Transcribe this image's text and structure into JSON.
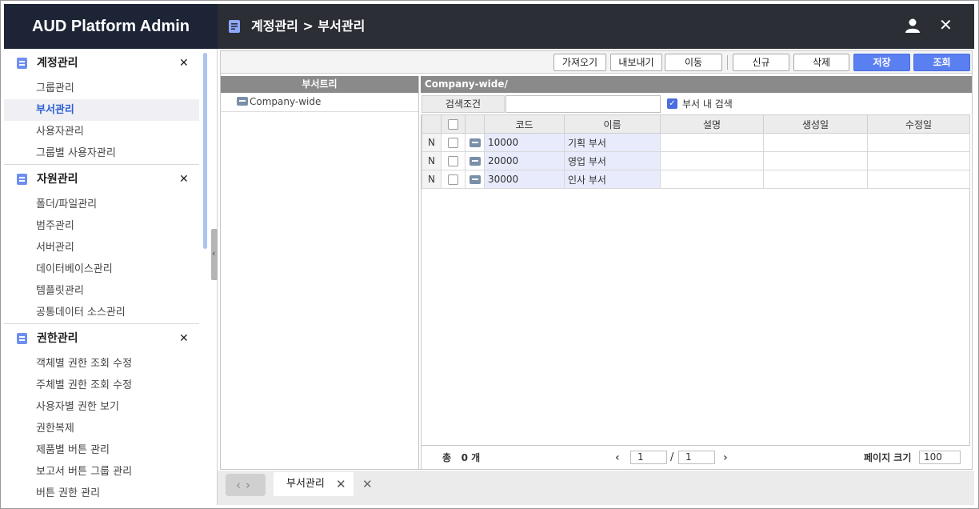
{
  "app": {
    "brand": "AUD Platform Admin"
  },
  "header": {
    "breadcrumb": "계정관리 > 부서관리"
  },
  "sidebar": {
    "groups": [
      {
        "label": "계정관리",
        "items": [
          "그룹관리",
          "부서관리",
          "사용자관리",
          "그룹별 사용자관리"
        ],
        "active": "부서관리"
      },
      {
        "label": "자원관리",
        "items": [
          "폴더/파일관리",
          "범주관리",
          "서버관리",
          "데이터베이스관리",
          "템플릿관리",
          "공통데이터 소스관리"
        ]
      },
      {
        "label": "권한관리",
        "items": [
          "객체별 권한 조회 수정",
          "주체별 권한 조회 수정",
          "사용자별 권한 보기",
          "권한복제",
          "제품별 버튼 관리",
          "보고서 버튼 그룹 관리",
          "버튼 권한 관리"
        ]
      }
    ]
  },
  "toolbar": {
    "import": "가져오기",
    "export": "내보내기",
    "move": "이동",
    "new": "신규",
    "delete": "삭제",
    "save": "저장",
    "search": "조회"
  },
  "tree": {
    "title": "부서트리",
    "nodes": [
      "Company-wide"
    ]
  },
  "grid": {
    "path": "Company-wide/",
    "search_label": "검색조건",
    "search_value": "",
    "within_dept_label": "부서 내 검색",
    "within_dept_checked": true,
    "columns": [
      "코드",
      "이름",
      "설명",
      "생성일",
      "수정일"
    ],
    "rows": [
      {
        "state": "N",
        "code": "10000",
        "name": "기획 부서",
        "desc": "",
        "created": "",
        "modified": ""
      },
      {
        "state": "N",
        "code": "20000",
        "name": "영업 부서",
        "desc": "",
        "created": "",
        "modified": ""
      },
      {
        "state": "N",
        "code": "30000",
        "name": "인사 부서",
        "desc": "",
        "created": "",
        "modified": ""
      }
    ]
  },
  "pager": {
    "total_prefix": "총",
    "total_count": "0",
    "total_suffix": "개",
    "page": "1",
    "slash": "/",
    "pages": "1",
    "page_size_label": "페이지 크기",
    "page_size": "100"
  },
  "tabs": [
    {
      "label": "부서관리"
    }
  ],
  "colors": {
    "brand_bg": "#1c2436",
    "header_bg": "#2b2e34",
    "primary": "#5a7ff0",
    "active_menu": "#2d5fd3"
  },
  "icons": [
    "document-icon",
    "user-icon",
    "close-icon",
    "comment-icon",
    "chevron-left-icon",
    "chevron-right-icon",
    "checkbox-icon"
  ]
}
